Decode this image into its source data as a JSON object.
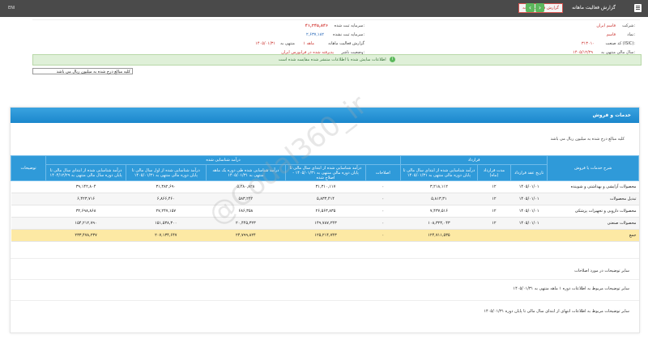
{
  "topbar": {
    "title": "گزارش فعالیت ماهانه",
    "status_badge": "گزارش فعالیت ماهانه",
    "prev_label": "‹",
    "next_label": "›",
    "corner_text": "ENI"
  },
  "info": {
    "company_label": "شرکت:",
    "company_value": "قاسم ایران",
    "symbol_label": "نماد:",
    "symbol_value": "قاسم",
    "isic_label": "کد صنعت (ISIC):",
    "isic_value": "۳۱۳۰۱۰",
    "period_label": "سال مالی منتهی به:",
    "period_value": "۱۴۰۵/۱۲/۲۹",
    "capital_label": "سرمایه ثبت شده:",
    "capital_value": "۴۱,۳۴۵,۸۴۶",
    "capital_unreg_label": "سرمایه ثبت نشده:",
    "capital_unreg_value": "۲,۶۳۷,۱۸۲",
    "report_label": "گزارش فعالیت ماهانه",
    "report_value": "۱ ماهه",
    "report_end_label": "منتهی به",
    "report_end_value": "۱۴۰۵/۰۱/۳۱",
    "status_label": "وضعیت ناشر:",
    "status_value": "پذیرفته شده در فرابورس ایران"
  },
  "notice": "اطلاعات سایش شده با اطلاعات منتشر شده مقایسه شده است",
  "unit_select": "کلیه مبالغ درج شده به میلیون ریال می باشد",
  "card": {
    "title": "خدمات و فروش",
    "note": "کلیه مبالغ درج شده به میلیون ریال می باشد"
  },
  "table": {
    "headers": {
      "description": "شرح خدمات یا فروش",
      "contract": "قرارداد",
      "recognized": "درآمد شناسایی شده",
      "notes": "توضیحات"
    },
    "subheaders": [
      "تاریخ عقد قرارداد",
      "مدت قرارداد (ماه)",
      "درآمد شناسایی شده از ابتدای سال مالی تا پایان دوره مالی منتهی به ۱۴۰۵/۰۱/۳۱",
      "اصلاحات",
      "درآمد شناسایی شده از ابتدای سال مالی تا پایان دوره مالی منتهی به ۱۴۰۵/۰۱/۳۱ - اصلاح شده",
      "درآمد شناسایی شده طی دوره یک ماهه منتهی به ۱۴۰۵/۰۱/۳۱",
      "درآمد شناسایی شده از اول سال مالی تا پایان دوره مالی منتهی به ۱۴۰۵/۰۱/۳۱",
      "درآمد شناسایی شده از ابتدای سال مالی تا پایان دوره سال مالی منتهی به ۱۴۰۴/۱۲/۲۹"
    ],
    "rows": [
      {
        "name": "محصولات آرایشی و بهداشتی و شوینده",
        "date": "۱۴۰۵/۰۱/۰۱",
        "months": "۱۲",
        "c1": "۳,۲۱۸,۱۱۲",
        "c2": "۰",
        "c3": "۳۱,۳۱۰,۱۱۷",
        "c4": "۵,۲۸۰,۸۲۸",
        "c5": "۳۱,۳۸۲,۶۹۰",
        "c6": "۳۹,۱۴۲,۸۰۴"
      },
      {
        "name": "تبدیل محصولات",
        "date": "۱۴۰۵/۰۱/۰۱",
        "months": "۱۲",
        "c1": "۵,۸۱۳,۳۱",
        "c2": "۰",
        "c3": "۵,۸۳۳,۴۱۴",
        "c4": "۵۸۳,۲۴۲",
        "c5": "۶,۸۶۶,۴۶۰",
        "c6": "۶,۴۲۳,۷۱۶"
      },
      {
        "name": "محصولات دارویی و تجهیزات پزشکی",
        "date": "۱۴۰۵/۰۱/۰۱",
        "months": "۱۲",
        "c1": "۷,۴۳۷,۵۱۶",
        "c2": "۰",
        "c3": "۲۶,۵۶۳,۸۳۵",
        "c4": "۶۸۶,۳۵۸",
        "c5": "۲۷,۲۴۷,۱۵۷",
        "c6": "۳۲,۶۹۸,۸۶۸"
      },
      {
        "name": "محصولات صنعتی",
        "date": "۱۴۰۵/۰۱/۰۱",
        "months": "۱۲",
        "c1": "۱۰۸,۳۲۳,۰۴۳",
        "c2": "۰",
        "c3": "۱۴۹,۷۸۷,۲۴۳",
        "c4": "۲۰,۴۴۵,۳۲۳",
        "c5": "۱۵۱,۵۳۸,۳۰۰",
        "c6": "۱۵۴,۲۱۲,۷۹۰"
      }
    ],
    "total": {
      "name": "جمع",
      "c1": "۱۲۴,۷۱۱,۵۳۵",
      "c2": "۰",
      "c3": "۱۲۵,۲۱۴,۷۴۳",
      "c4": "۲۴,۷۹۹,۸۲۴",
      "c5": "۲۰۷,۱۳۴,۶۴۷",
      "c6": "۲۳۳,۴۷۸,۲۳۷"
    }
  },
  "footnotes": {
    "f1": "سایر توضیحات در مورد اصلاحات",
    "f2": "سایر توضیحات مربوط به اطلاعات دوره ۱ ماهه منتهی به ۱۴۰۵/۰۱/۳۱",
    "f3": "سایر توضیحات مربوط به اطلاعات انتهای از ابتدای سال مالی تا پایان دوره ۱۴۰۵/۰۱/۳۱"
  },
  "watermark": "@Codal360_ir"
}
